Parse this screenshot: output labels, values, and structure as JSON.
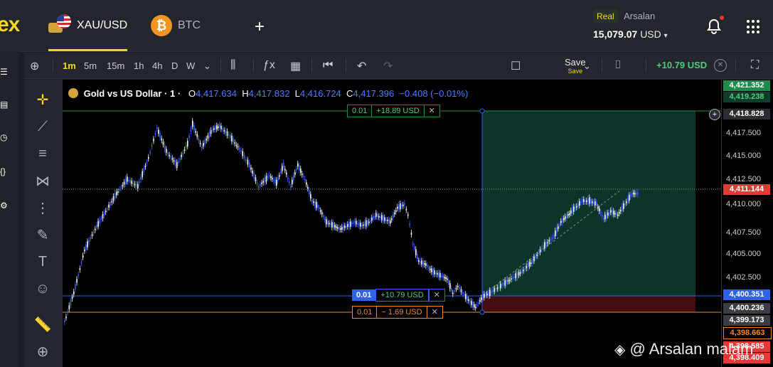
{
  "topbar": {
    "logo": "ex",
    "tabs": [
      {
        "label": "XAU/USD",
        "icon": "gold-usd-flag-icon",
        "active": true
      },
      {
        "label": "BTC",
        "icon": "bitcoin-icon",
        "active": false
      }
    ],
    "account_type": "Real",
    "account_name": "Arsalan",
    "balance": "15,079.07",
    "currency": "USD"
  },
  "toolbar": {
    "timeframes": [
      "1m",
      "5m",
      "15m",
      "1h",
      "4h",
      "D",
      "W"
    ],
    "active_timeframe": "1m",
    "save_label": "Save",
    "save_sub": "Save",
    "pnl": "+10.79 USD"
  },
  "legend": {
    "title": "Gold vs US Dollar · 1 ·",
    "o_label": "O",
    "o": "4,417.634",
    "h_label": "H",
    "h": "4,417.832",
    "l_label": "L",
    "l": "4,416.724",
    "c_label": "C",
    "c": "4,417.396",
    "change": "−0.408 (−0.01%)"
  },
  "orders": {
    "tp": {
      "qty": "0.01",
      "pnl": "+18.89 USD"
    },
    "entry": {
      "qty": "0.01",
      "pnl": "+10.79 USD"
    },
    "sl": {
      "qty": "0.01",
      "pnl": "− 1.69 USD"
    }
  },
  "axis": {
    "ticks": [
      "4,417.500",
      "4,415.000",
      "4,412.500",
      "4,410.000",
      "4,407.500",
      "4,405.000",
      "4,402.500"
    ],
    "labels": [
      {
        "text": "4,421.352",
        "bg": "#1e8a4c",
        "fg": "#ffffff"
      },
      {
        "text": "4,419.238",
        "bg": "#0f3d29",
        "fg": "#4cd07a"
      },
      {
        "text": "4,418.828",
        "bg": "#2a2d33",
        "fg": "#ffffff"
      },
      {
        "text": "4,411.144",
        "bg": "#e53935",
        "fg": "#ffffff"
      },
      {
        "text": "4,400.351",
        "bg": "#2f62e8",
        "fg": "#ffffff"
      },
      {
        "text": "4,400.236",
        "bg": "#3a3d44",
        "fg": "#ffffff"
      },
      {
        "text": "4,399.173",
        "bg": "#3a3d44",
        "fg": "#ffffff"
      },
      {
        "text": "4,398.663",
        "bg": "#000000",
        "fg": "#f08a24"
      },
      {
        "text": "4,398.585",
        "bg": "#e53935",
        "fg": "#ffffff"
      },
      {
        "text": "4,398.409",
        "bg": "#e53935",
        "fg": "#ffffff"
      }
    ]
  },
  "watermark": "@ Arsalan malam",
  "colors": {
    "accent": "#f5d623",
    "up": "#ffffff",
    "down": "#2f62e8",
    "profit": "#4cd07a",
    "loss": "#e53935"
  }
}
